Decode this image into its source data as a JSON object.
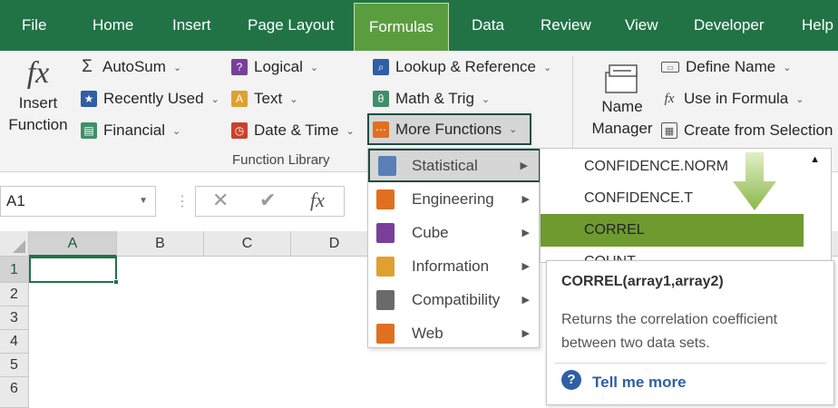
{
  "tabs": [
    "File",
    "Home",
    "Insert",
    "Page Layout",
    "Formulas",
    "Data",
    "Review",
    "View",
    "Developer",
    "Help"
  ],
  "active_tab": "Formulas",
  "ribbon": {
    "insert_function": [
      "Insert",
      "Function"
    ],
    "autosum": "AutoSum",
    "recently_used": "Recently Used",
    "financial": "Financial",
    "logical": "Logical",
    "text": "Text",
    "date_time": "Date & Time",
    "lookup_reference": "Lookup & Reference",
    "math_trig": "Math & Trig",
    "more_functions": "More Functions",
    "function_library": "Function Library",
    "name_manager": [
      "Name",
      "Manager"
    ],
    "define_name": "Define Name",
    "use_in_formula": "Use in Formula",
    "create_from_selection": "Create from Selection"
  },
  "formula_bar": {
    "name_box": "A1",
    "fx": "fx"
  },
  "grid": {
    "columns": [
      "A",
      "B",
      "C",
      "D"
    ],
    "rows": [
      "1",
      "2",
      "3",
      "4",
      "5",
      "6"
    ]
  },
  "more_functions_menu": [
    "Statistical",
    "Engineering",
    "Cube",
    "Information",
    "Compatibility",
    "Web"
  ],
  "statistical_submenu": [
    "CONFIDENCE.NORM",
    "CONFIDENCE.T",
    "CORREL",
    "COUNT"
  ],
  "tooltip": {
    "signature": "CORREL(array1,array2)",
    "description": "Returns the correlation coefficient between two data sets.",
    "tell_me_more": "Tell me more"
  },
  "colors": {
    "tab_bar": "#217346",
    "active_tab": "#5a9d3f",
    "highlight_item": "#6e9a2f",
    "link": "#2f5fa5"
  }
}
